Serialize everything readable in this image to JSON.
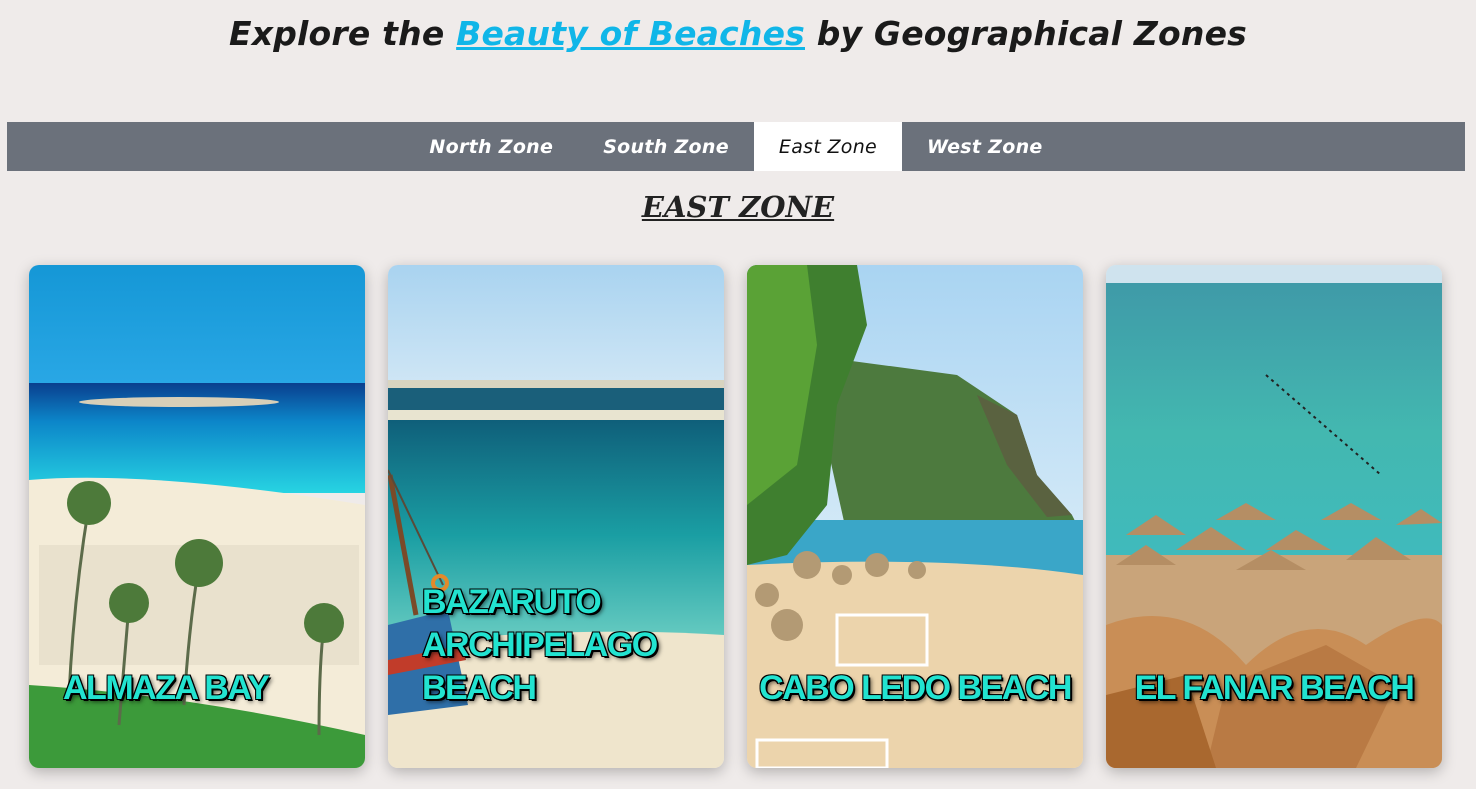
{
  "header": {
    "prefix": "Explore the",
    "link_text": "Beauty of Beaches",
    "suffix": "by Geographical Zones"
  },
  "nav": {
    "tabs": [
      {
        "label": "North Zone",
        "active": false
      },
      {
        "label": "South Zone",
        "active": false
      },
      {
        "label": "East Zone",
        "active": true
      },
      {
        "label": "West Zone",
        "active": false
      }
    ]
  },
  "section": {
    "title": "EAST ZONE"
  },
  "cards": [
    {
      "title": "ALMAZA BAY"
    },
    {
      "title": "BAZARUTO ARCHIPELAGO BEACH"
    },
    {
      "title": "CABO LEDO BEACH"
    },
    {
      "title": "EL FANAR BEACH"
    }
  ],
  "colors": {
    "background": "#efebea",
    "nav_bar": "#6b717b",
    "link": "#10b6e8",
    "card_label": "#22e3d0"
  }
}
